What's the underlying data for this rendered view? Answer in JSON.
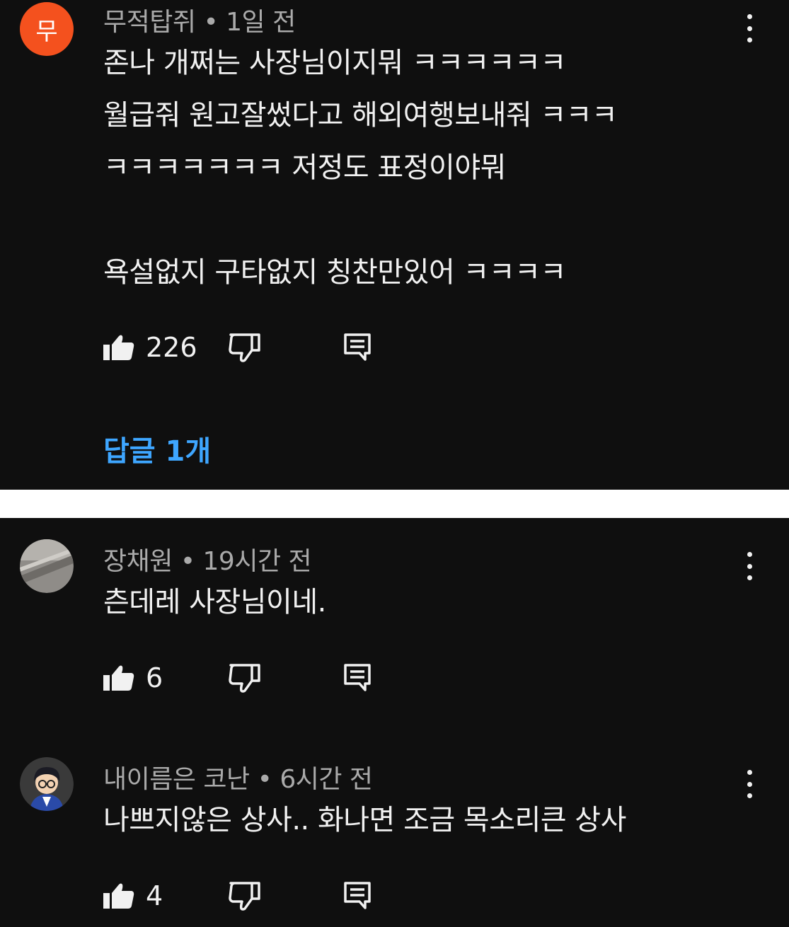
{
  "comments": [
    {
      "avatar_letter": "무",
      "author": "무적탑쥐",
      "time": "1일 전",
      "text": "존나 개쩌는 사장님이지뭐 ㅋㅋㅋㅋㅋㅋ\n월급줘 원고잘썼다고 해외여행보내줘 ㅋㅋㅋ\nㅋㅋㅋㅋㅋㅋㅋ 저정도 표정이야뭐\n\n욕설없지 구타없지  칭찬만있어 ㅋㅋㅋㅋ",
      "likes": "226",
      "replies_label": "답글 1개"
    },
    {
      "author": "장채원",
      "time": "19시간 전",
      "text": "츤데레 사장님이네.",
      "likes": "6"
    },
    {
      "author": "내이름은 코난",
      "time": "6시간 전",
      "text": "나쁘지않은 상사.. 화나면 조금 목소리큰 상사",
      "likes": "4"
    }
  ],
  "separator": "•",
  "colors": {
    "background": "#0f0f0f",
    "text": "#f1f1f1",
    "meta": "#aaaaaa",
    "link": "#3ea6ff",
    "avatar_orange": "#f4511e"
  },
  "icons": [
    "more-vert-icon",
    "thumbs-up-icon",
    "thumbs-down-icon",
    "reply-icon"
  ]
}
